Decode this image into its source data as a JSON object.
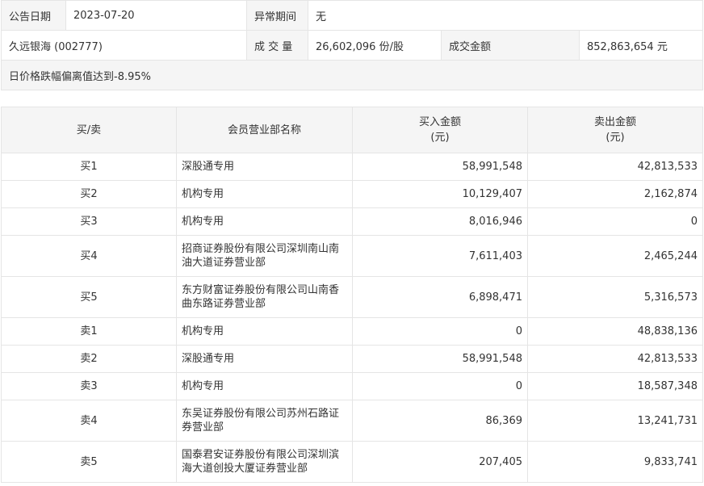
{
  "info": {
    "date_label": "公告日期",
    "date_value": "2023-07-20",
    "abnormal_label": "异常期间",
    "abnormal_value": "无",
    "stock_name": "久远银海 (002777)",
    "volume_label": "成 交 量",
    "volume_value": "26,602,096 份/股",
    "amount_label": "成交金额",
    "amount_value": "852,863,654 元",
    "reason": "日价格跌幅偏离值达到-8.95%"
  },
  "table": {
    "headers": {
      "side": "买/卖",
      "name": "会员营业部名称",
      "buy": "买入金额",
      "buy_unit": "(元)",
      "sell": "卖出金额",
      "sell_unit": "(元)"
    },
    "rows": [
      {
        "side": "买1",
        "name": "深股通专用",
        "buy": "58,991,548",
        "sell": "42,813,533"
      },
      {
        "side": "买2",
        "name": "机构专用",
        "buy": "10,129,407",
        "sell": "2,162,874"
      },
      {
        "side": "买3",
        "name": "机构专用",
        "buy": "8,016,946",
        "sell": "0"
      },
      {
        "side": "买4",
        "name": "招商证券股份有限公司深圳南山南油大道证券营业部",
        "buy": "7,611,403",
        "sell": "2,465,244"
      },
      {
        "side": "买5",
        "name": "东方财富证券股份有限公司山南香曲东路证券营业部",
        "buy": "6,898,471",
        "sell": "5,316,573"
      },
      {
        "side": "卖1",
        "name": "机构专用",
        "buy": "0",
        "sell": "48,838,136"
      },
      {
        "side": "卖2",
        "name": "深股通专用",
        "buy": "58,991,548",
        "sell": "42,813,533"
      },
      {
        "side": "卖3",
        "name": "机构专用",
        "buy": "0",
        "sell": "18,587,348"
      },
      {
        "side": "卖4",
        "name": "东吴证券股份有限公司苏州石路证券营业部",
        "buy": "86,369",
        "sell": "13,241,731"
      },
      {
        "side": "卖5",
        "name": "国泰君安证券股份有限公司深圳滨海大道创投大厦证券营业部",
        "buy": "207,405",
        "sell": "9,833,741"
      }
    ]
  }
}
